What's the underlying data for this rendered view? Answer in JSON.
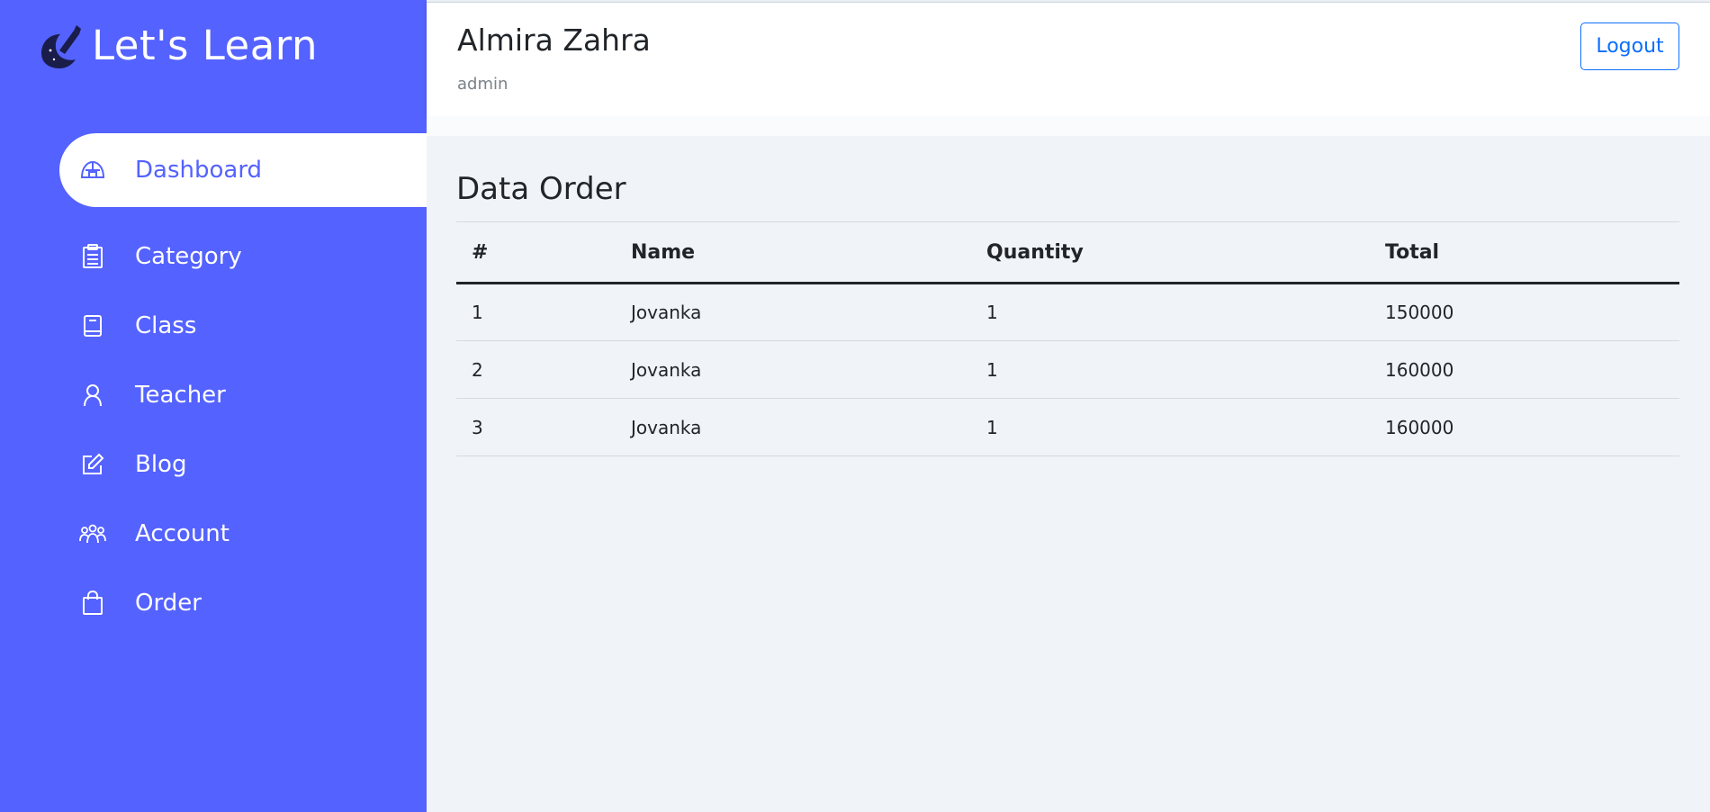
{
  "app": {
    "brand": "Let's Learn",
    "accent_color": "#5462ff"
  },
  "sidebar": {
    "items": [
      {
        "label": "Dashboard",
        "icon": "igloo-icon",
        "active": true
      },
      {
        "label": "Category",
        "icon": "clipboard-list-icon",
        "active": false
      },
      {
        "label": "Class",
        "icon": "book-icon",
        "active": false
      },
      {
        "label": "Teacher",
        "icon": "person-icon",
        "active": false
      },
      {
        "label": "Blog",
        "icon": "pencil-square-icon",
        "active": false
      },
      {
        "label": "Account",
        "icon": "people-group-icon",
        "active": false
      },
      {
        "label": "Order",
        "icon": "shopping-bag-icon",
        "active": false
      }
    ]
  },
  "header": {
    "user_name": "Almira Zahra",
    "user_role": "admin",
    "logout_label": "Logout"
  },
  "main": {
    "title": "Data Order",
    "table": {
      "columns": [
        "#",
        "Name",
        "Quantity",
        "Total"
      ],
      "rows": [
        [
          "1",
          "Jovanka",
          "1",
          "150000"
        ],
        [
          "2",
          "Jovanka",
          "1",
          "160000"
        ],
        [
          "3",
          "Jovanka",
          "1",
          "160000"
        ]
      ]
    }
  }
}
